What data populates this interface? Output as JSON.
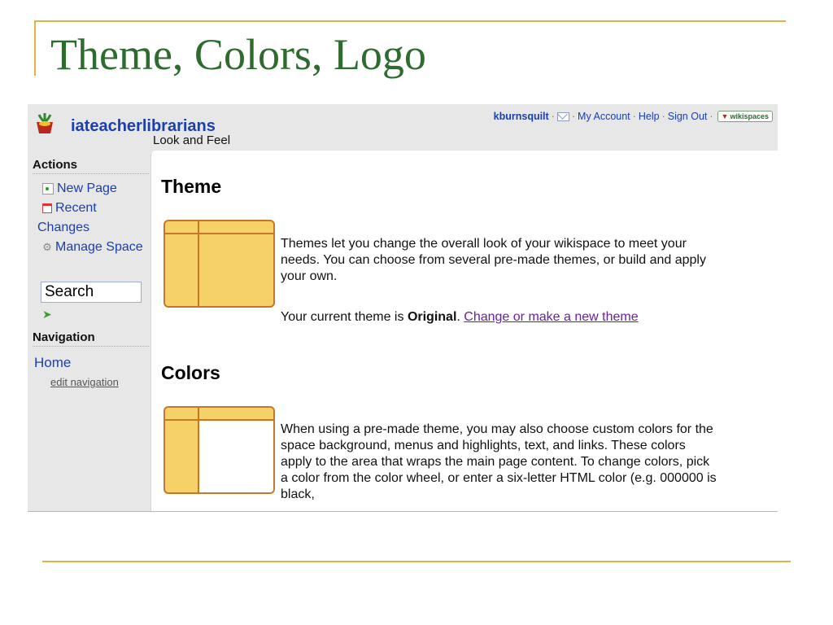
{
  "slide": {
    "title": "Theme, Colors, Logo"
  },
  "header": {
    "site_name": "iateacherlibrarians",
    "page_subtitle": "Look and Feel",
    "user_nav": {
      "username": "kburnsquilt",
      "my_account": "My Account",
      "help": "Help",
      "sign_out": "Sign Out",
      "badge": "wikispaces",
      "separator": "·"
    }
  },
  "sidebar": {
    "actions_heading": "Actions",
    "new_page": "New Page",
    "recent_changes": "Recent Changes",
    "manage_space": "Manage Space",
    "search_value": "Search",
    "navigation_heading": "Navigation",
    "home": "Home",
    "edit_navigation": "edit navigation"
  },
  "content": {
    "theme": {
      "heading": "Theme",
      "description": "Themes let you change the overall look of your wikispace to meet your needs. You can choose from several pre-made themes, or build and apply your own.",
      "current_prefix": "Your current theme is ",
      "current_theme": "Original",
      "current_suffix": ". ",
      "change_link": "Change or make a new theme"
    },
    "colors": {
      "heading": "Colors",
      "description": "When using a pre-made theme, you may also choose custom colors for the space background, menus and highlights, text, and links. These colors apply to the area that wraps the main page content. To change colors, pick a color from the color wheel, or enter a six-letter HTML color (e.g. 000000 is black,"
    }
  },
  "colors": {
    "title_green": "#2e6b2e",
    "accent_gold": "#e0b24a",
    "link_blue": "#1a3fb0",
    "visited_purple": "#6a1fa0",
    "thumb_fill": "#f6d168",
    "thumb_border": "#c7772a"
  }
}
